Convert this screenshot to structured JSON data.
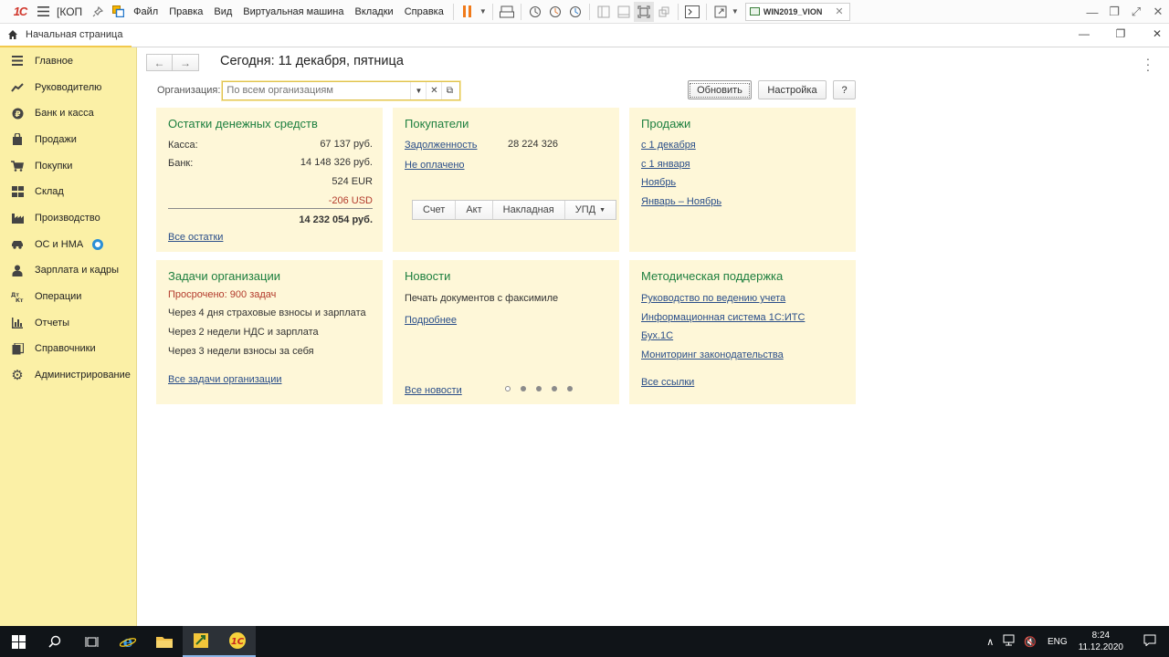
{
  "titlebar": {
    "doc_title": "[КОП",
    "menu": [
      "Файл",
      "Правка",
      "Вид",
      "Виртуальная машина",
      "Вкладки",
      "Справка"
    ],
    "vm_tab": "WIN2019_VION",
    "logo_text": "1С"
  },
  "tabs": {
    "home": "Начальная страница"
  },
  "sidebar": {
    "items": [
      {
        "label": "Главное",
        "icon": "menu-lines-icon"
      },
      {
        "label": "Руководителю",
        "icon": "trend-icon"
      },
      {
        "label": "Банк и касса",
        "icon": "ruble-coin-icon"
      },
      {
        "label": "Продажи",
        "icon": "bag-icon"
      },
      {
        "label": "Покупки",
        "icon": "cart-icon"
      },
      {
        "label": "Склад",
        "icon": "grid-icon"
      },
      {
        "label": "Производство",
        "icon": "factory-icon"
      },
      {
        "label": "ОС и НМА",
        "icon": "car-icon"
      },
      {
        "label": "Зарплата и кадры",
        "icon": "person-icon"
      },
      {
        "label": "Операции",
        "icon": "dt-kt-icon"
      },
      {
        "label": "Отчеты",
        "icon": "bar-chart-icon"
      },
      {
        "label": "Справочники",
        "icon": "books-icon"
      },
      {
        "label": "Администрирование",
        "icon": "gear-icon"
      }
    ]
  },
  "main": {
    "title": "Сегодня: 11 декабря, пятница",
    "org_label": "Организация:",
    "org_placeholder": "По всем организациям",
    "refresh": "Обновить",
    "settings": "Настройка",
    "help": "?"
  },
  "cards": {
    "cash": {
      "title": "Остатки денежных средств",
      "kassa_label": "Касса:",
      "kassa_value": "67 137 руб.",
      "bank_label": "Банк:",
      "bank_value": "14 148 326 руб.",
      "eur_value": "524 EUR",
      "usd_value": "-206 USD",
      "total": "14 232 054 руб.",
      "all_link": "Все остатки"
    },
    "buyers": {
      "title": "Покупатели",
      "debt_link": "Задолженность",
      "debt_value": "28 224 326",
      "unpaid_link": "Не оплачено",
      "doc_buttons": [
        "Счет",
        "Акт",
        "Накладная",
        "УПД"
      ]
    },
    "sales": {
      "title": "Продажи",
      "links": [
        "с 1 декабря",
        "с 1 января",
        "Ноябрь",
        "Январь – Ноябрь"
      ]
    },
    "tasks": {
      "title": "Задачи организации",
      "overdue": "Просрочено: 900 задач",
      "items": [
        "Через 4 дня страховые взносы и зарплата",
        "Через 2 недели НДС и зарплата",
        "Через 3 недели взносы за себя"
      ],
      "all_link": "Все задачи организации"
    },
    "news": {
      "title": "Новости",
      "text": "Печать документов с факсимиле",
      "more_link": "Подробнее",
      "all_link": "Все новости"
    },
    "support": {
      "title": "Методическая поддержка",
      "links": [
        "Руководство по ведению учета",
        "Информационная система 1С:ИТС",
        "Бух.1С",
        "Мониторинг законодательства"
      ],
      "all_link": "Все ссылки"
    }
  },
  "taskbar": {
    "lang": "ENG",
    "time": "8:24",
    "date": "11.12.2020"
  },
  "colors": {
    "sidebar_bg": "#fbf0a6",
    "card_bg": "#fef7d8",
    "card_title": "#1d7f3f",
    "link": "#2a4e89",
    "overdue": "#b33b2c"
  }
}
